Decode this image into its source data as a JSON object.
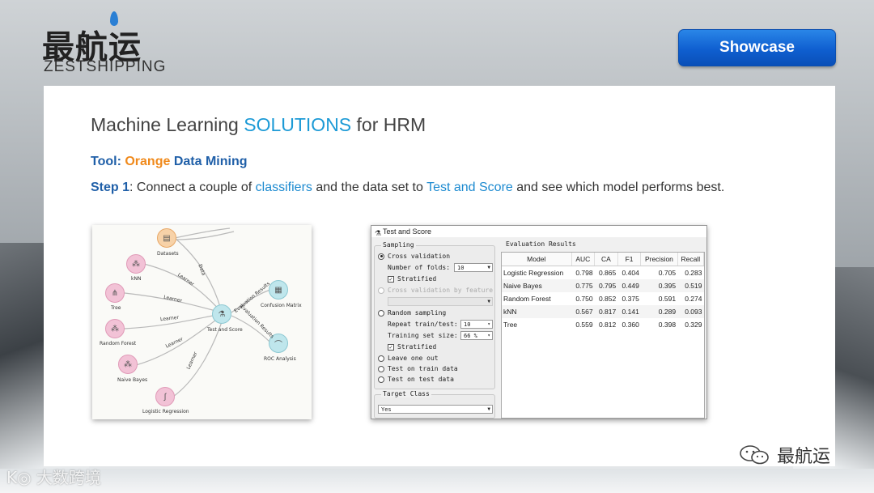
{
  "logo": {
    "cn": "最航运",
    "en": "ZESTSHIPPING"
  },
  "showcase_label": "Showcase",
  "slide": {
    "title_pre": "Machine Learning ",
    "title_hl": "SOLUTIONS",
    "title_post": " for HRM",
    "tool_label": "Tool: ",
    "tool_orange": "Orange",
    "tool_rest": " Data Mining",
    "step_label": "Step 1",
    "step_t1": ": Connect a couple of ",
    "step_hl1": "classifiers",
    "step_t2": " and the data set to ",
    "step_hl2": "Test and Score",
    "step_t3": " and see which model performs best."
  },
  "workflow": {
    "nodes": {
      "datasets": "Datasets",
      "knn": "kNN",
      "tree": "Tree",
      "random_forest": "Random Forest",
      "naive_bayes": "Naive Bayes",
      "logistic_regression": "Logistic Regression",
      "test_and_score": "Test and Score",
      "confusion_matrix": "Confusion Matrix",
      "roc_analysis": "ROC Analysis"
    },
    "edges": {
      "data": "Data",
      "learner1": "Learner",
      "learner2": "Learner",
      "learner3": "Learner",
      "learner4": "Learner",
      "learner5": "Learner",
      "eval1": "Evaluation Results",
      "eval2": "Evaluation Results"
    }
  },
  "dialog": {
    "title": "Test and Score",
    "sampling": "Sampling",
    "cross_validation": "Cross validation",
    "number_of_folds": "Number of folds:",
    "folds_value": "10",
    "stratified": "Stratified",
    "cv_by_feature": "Cross validation by feature",
    "random_sampling": "Random sampling",
    "repeat_train_test": "Repeat train/test:",
    "repeat_value": "10",
    "training_set_size": "Training set size:",
    "training_value": "66 %",
    "stratified2": "Stratified",
    "leave_one_out": "Leave one out",
    "test_on_train": "Test on train data",
    "test_on_test": "Test on test data",
    "target_class": "Target Class",
    "target_value": "Yes",
    "eval_title": "Evaluation Results",
    "columns": [
      "Model",
      "AUC",
      "CA",
      "F1",
      "Precision",
      "Recall"
    ],
    "rows": [
      [
        "Logistic Regression",
        "0.798",
        "0.865",
        "0.404",
        "0.705",
        "0.283"
      ],
      [
        "Naive Bayes",
        "0.775",
        "0.795",
        "0.449",
        "0.395",
        "0.519"
      ],
      [
        "Random Forest",
        "0.750",
        "0.852",
        "0.375",
        "0.591",
        "0.274"
      ],
      [
        "kNN",
        "0.567",
        "0.817",
        "0.141",
        "0.289",
        "0.093"
      ],
      [
        "Tree",
        "0.559",
        "0.812",
        "0.360",
        "0.398",
        "0.329"
      ]
    ]
  },
  "footer": {
    "wechat_name": "最航运",
    "watermark": "K◎ 大数跨境"
  }
}
